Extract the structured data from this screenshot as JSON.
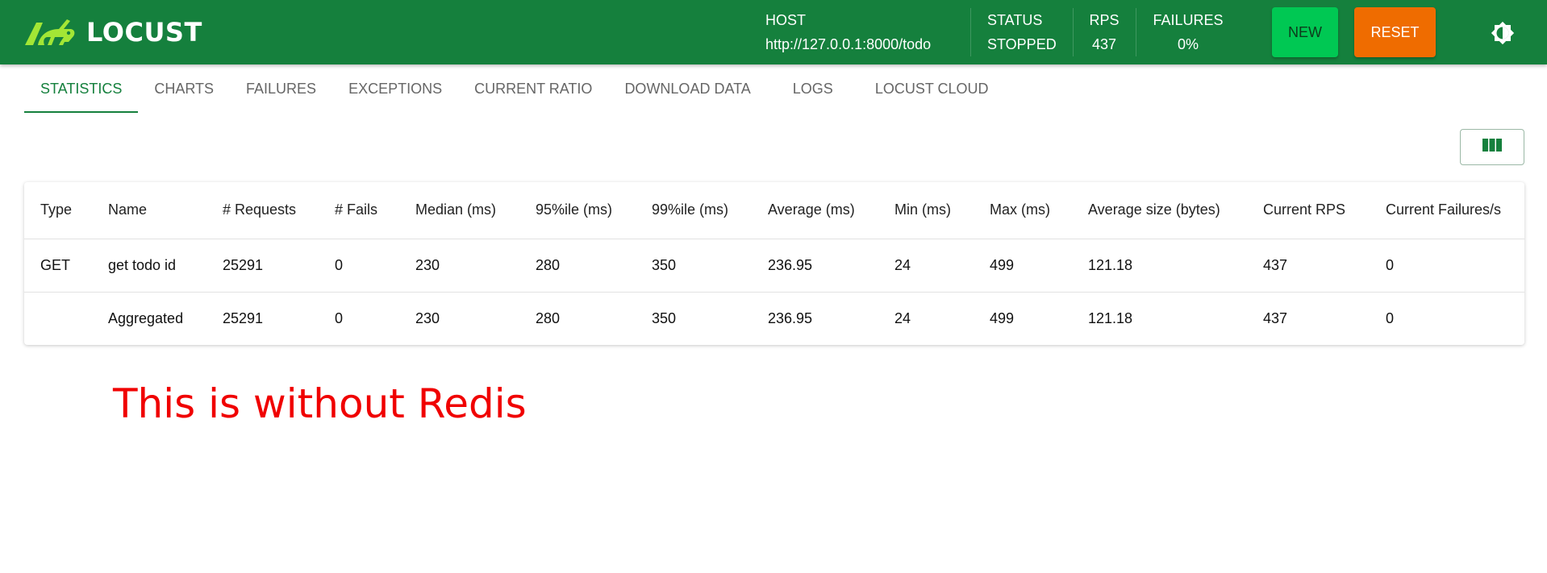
{
  "app": {
    "name": "LOCUST"
  },
  "header": {
    "host": {
      "label": "HOST",
      "value": "http://127.0.0.1:8000/todo"
    },
    "status": {
      "label": "STATUS",
      "value": "STOPPED"
    },
    "rps": {
      "label": "RPS",
      "value": "437"
    },
    "failures": {
      "label": "FAILURES",
      "value": "0%"
    },
    "new_label": "NEW",
    "reset_label": "RESET",
    "colors": {
      "bar": "#15803d",
      "new": "#00c853",
      "reset": "#ef6c00",
      "logo": "#a3e635"
    }
  },
  "tabs": [
    {
      "label": "STATISTICS",
      "active": true
    },
    {
      "label": "CHARTS"
    },
    {
      "label": "FAILURES"
    },
    {
      "label": "EXCEPTIONS"
    },
    {
      "label": "CURRENT RATIO"
    },
    {
      "label": "DOWNLOAD DATA"
    },
    {
      "label": "LOGS"
    },
    {
      "label": "LOCUST CLOUD"
    }
  ],
  "table": {
    "columns": [
      "Type",
      "Name",
      "# Requests",
      "# Fails",
      "Median (ms)",
      "95%ile (ms)",
      "99%ile (ms)",
      "Average (ms)",
      "Min (ms)",
      "Max (ms)",
      "Average size (bytes)",
      "Current RPS",
      "Current Failures/s"
    ],
    "rows": [
      [
        "GET",
        "get todo id",
        "25291",
        "0",
        "230",
        "280",
        "350",
        "236.95",
        "24",
        "499",
        "121.18",
        "437",
        "0"
      ],
      [
        "",
        "Aggregated",
        "25291",
        "0",
        "230",
        "280",
        "350",
        "236.95",
        "24",
        "499",
        "121.18",
        "437",
        "0"
      ]
    ]
  },
  "annotation": {
    "text": "This is without Redis",
    "color": "#f00000"
  },
  "icons": [
    "locust-logo-icon",
    "theme-toggle-icon",
    "view-columns-icon"
  ]
}
